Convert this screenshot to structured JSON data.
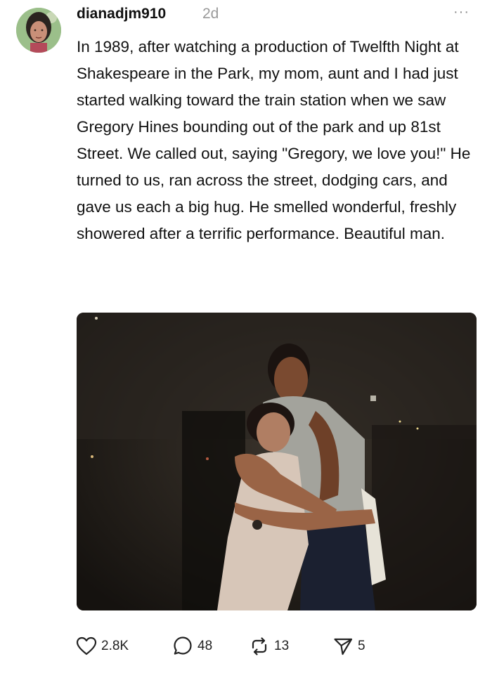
{
  "post": {
    "username": "dianadjm910",
    "time": "2d",
    "more_label": "···",
    "text": "In 1989, after watching a production of Twelfth Night at Shakespeare in the Park, my mom, aunt and I had just started walking toward the train station when we saw Gregory Hines bounding out of the park and up 81st Street. We called out, saying \"Gregory, we love you!\" He turned to us, ran across the street, dodging cars, and gave us each a big hug. He smelled wonderful, freshly showered after a terrific performance. Beautiful man."
  },
  "actions": {
    "likes": "2.8K",
    "replies": "48",
    "reposts": "13",
    "shares": "5"
  },
  "icons": {
    "like": "heart-icon",
    "reply": "comment-bubble-icon",
    "repost": "repost-icon",
    "share": "send-icon",
    "more": "more-dots-icon"
  }
}
